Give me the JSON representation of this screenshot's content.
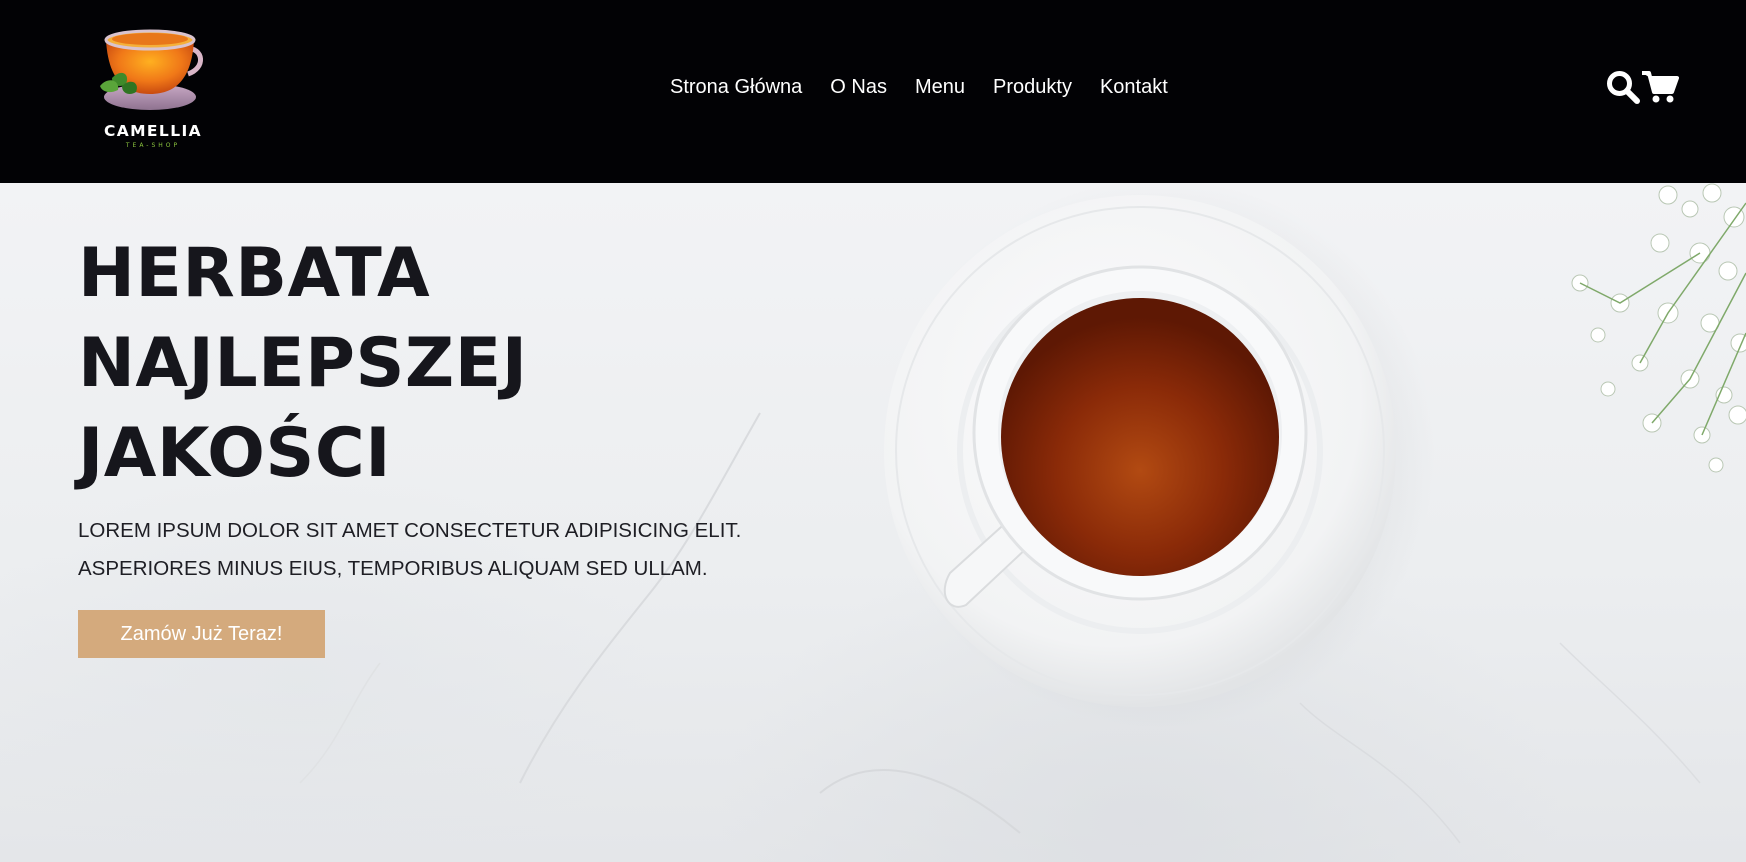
{
  "brand": {
    "name": "CAMELLIA",
    "tagline": "TEA-SHOP",
    "icon": "tea-cup-logo"
  },
  "nav": {
    "items": [
      {
        "label": "Strona Główna"
      },
      {
        "label": "O Nas"
      },
      {
        "label": "Menu"
      },
      {
        "label": "Produkty"
      },
      {
        "label": "Kontakt"
      }
    ]
  },
  "header_icons": {
    "search": "search-icon",
    "cart": "cart-icon"
  },
  "hero": {
    "title_lines": [
      "HERBATA",
      "NAJLEPSZEJ",
      "JAKOŚCI"
    ],
    "description_lines": [
      "LOREM IPSUM DOLOR SIT AMET CONSECTETUR ADIPISICING ELIT.",
      "ASPERIORES MINUS EIUS, TEMPORIBUS ALIQUAM SED ULLAM."
    ],
    "cta_label": "Zamów Już Teraz!"
  },
  "colors": {
    "header_bg": "#020205",
    "accent": "#d4aa7d",
    "heading_text": "#16161c",
    "nav_text": "#ffffff",
    "tea": "#a0360d"
  }
}
